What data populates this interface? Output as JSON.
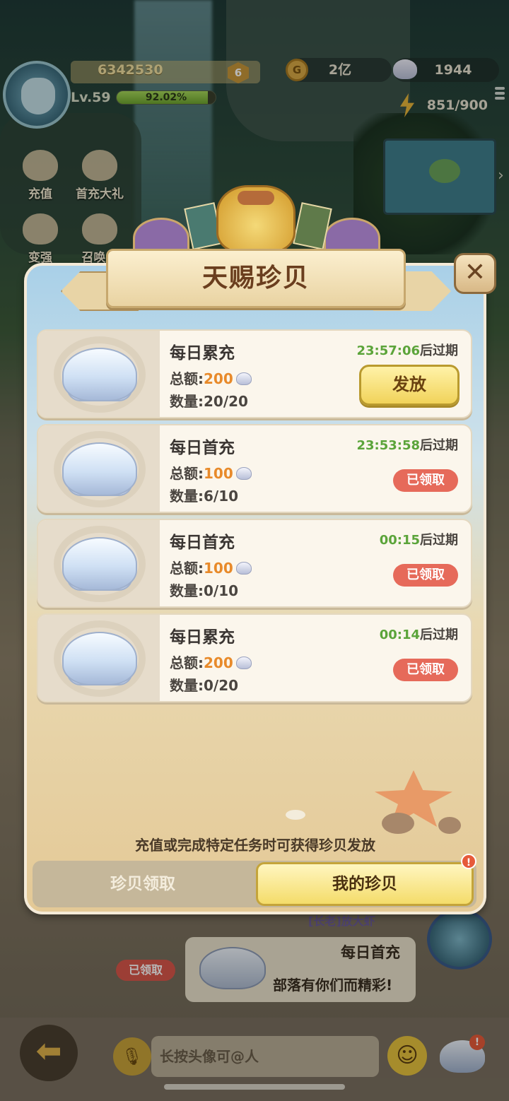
{
  "hud": {
    "score": "6342530",
    "rank": "6",
    "level": "Lv.59",
    "xp_percent": "92.02%",
    "xp_fraction": 0.9202,
    "coins": "2亿",
    "shells": "1944",
    "energy": "851/900"
  },
  "side_menu": [
    {
      "label": "充值"
    },
    {
      "label": "首充大礼"
    },
    {
      "label": "变强"
    },
    {
      "label": "召唤巨"
    }
  ],
  "modal": {
    "title": "天赐珍贝",
    "close_label": "✕",
    "cards": [
      {
        "name": "每日累充",
        "total_label": "总额:",
        "total": "200",
        "count_label": "数量:",
        "count": "20/20",
        "timer": "23:57:06",
        "timer_suffix": "后过期",
        "action": "发放"
      },
      {
        "name": "每日首充",
        "total_label": "总额:",
        "total": "100",
        "count_label": "数量:",
        "count": "6/10",
        "timer": "23:53:58",
        "timer_suffix": "后过期",
        "action": "已领取"
      },
      {
        "name": "每日首充",
        "total_label": "总额:",
        "total": "100",
        "count_label": "数量:",
        "count": "0/10",
        "timer": "00:15",
        "timer_suffix": "后过期",
        "action": "已领取"
      },
      {
        "name": "每日累充",
        "total_label": "总额:",
        "total": "200",
        "count_label": "数量:",
        "count": "0/20",
        "timer": "00:14",
        "timer_suffix": "后过期",
        "action": "已领取"
      }
    ],
    "hint": "充值或完成特定任务时可获得珍贝发放",
    "tabs": {
      "claim": "珍贝领取",
      "mine": "我的珍贝",
      "badge": "!"
    }
  },
  "chat": {
    "sender": "[长老]放大虾",
    "claimed": "已领取",
    "title": "每日首充",
    "message": "部落有你们而精彩!",
    "input_placeholder": "长按头像可@人",
    "back_icon": "arrow-left-icon",
    "mic_icon": "microphone-icon",
    "emoji_icon": "smiley-icon",
    "shell_badge": "!"
  }
}
